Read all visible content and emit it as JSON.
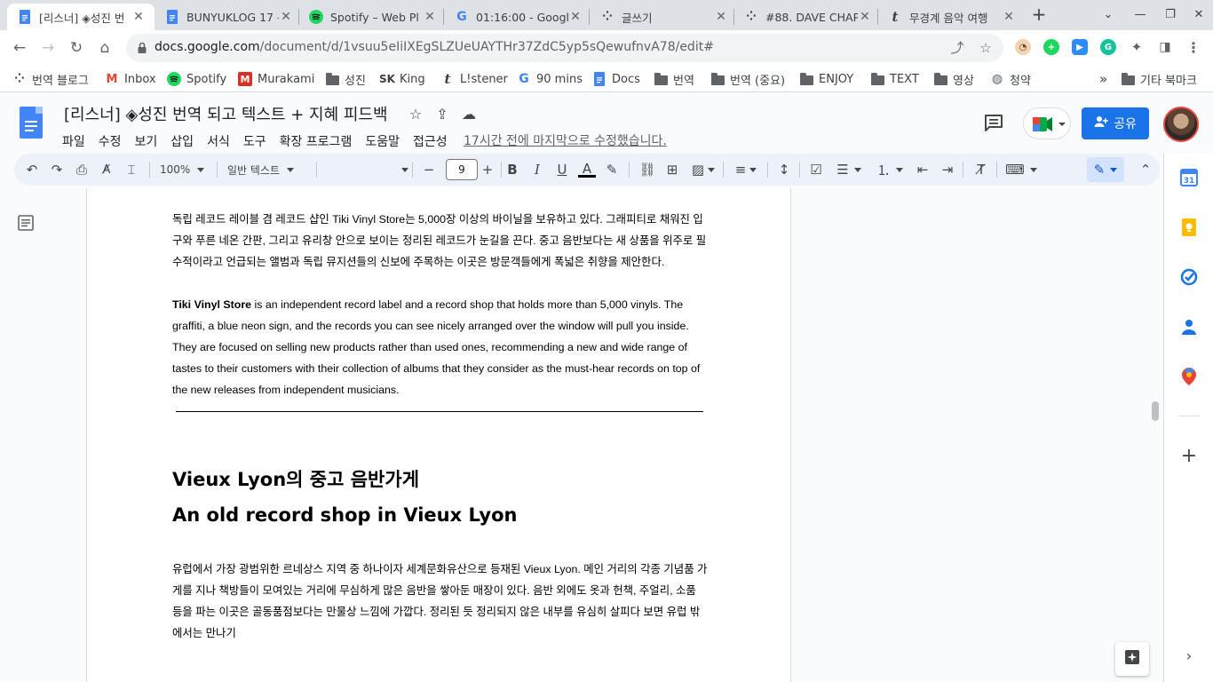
{
  "browser": {
    "tabs": [
      {
        "title": "[리스너] ◈성진 번",
        "icon": "docs-icon",
        "active": true
      },
      {
        "title": "BUNYUKLOG 17 -",
        "icon": "docs-icon",
        "active": false
      },
      {
        "title": "Spotify – Web Pl",
        "icon": "spotify-icon",
        "active": false
      },
      {
        "title": "01:16:00 - Googl",
        "icon": "google-icon",
        "active": false
      },
      {
        "title": "글쓰기",
        "icon": "dots-icon",
        "active": false
      },
      {
        "title": "#88. DAVE CHAP",
        "icon": "dots-icon",
        "active": false
      },
      {
        "title": "무경계 음악 여행",
        "icon": "t-icon",
        "active": false
      }
    ],
    "url_host": "docs.google.com",
    "url_path": "/document/d/1vsuu5eIiIXEgSLZUeUAYTHr37ZdC5yp5sQewufnvA78/edit#",
    "bookmarks": [
      {
        "label": "번역 블로그",
        "icon": "dots-icon"
      },
      {
        "label": "Inbox",
        "icon": "gmail-icon"
      },
      {
        "label": "Spotify",
        "icon": "spotify-icon"
      },
      {
        "label": "Murakami",
        "icon": "m-icon"
      },
      {
        "label": "성진",
        "icon": "folder-icon"
      },
      {
        "label": "King",
        "icon": "sk-icon"
      },
      {
        "label": "L!stener",
        "icon": "t-icon"
      },
      {
        "label": "90 mins",
        "icon": "google-icon"
      },
      {
        "label": "Docs",
        "icon": "docs-icon"
      },
      {
        "label": "번역",
        "icon": "folder-icon"
      },
      {
        "label": "번역 (중요)",
        "icon": "folder-icon"
      },
      {
        "label": "ENJOY",
        "icon": "folder-icon"
      },
      {
        "label": "TEXT",
        "icon": "folder-icon"
      },
      {
        "label": "영상",
        "icon": "folder-icon"
      },
      {
        "label": "청약",
        "icon": "globe-icon"
      }
    ],
    "bookmarks_overflow": "»",
    "other_bookmarks": "기타 북마크"
  },
  "docs": {
    "title": "[리스너] ◈성진 번역 되고 텍스트 + 지혜 피드백",
    "menu": [
      "파일",
      "수정",
      "보기",
      "삽입",
      "서식",
      "도구",
      "확장 프로그램",
      "도움말",
      "접근성"
    ],
    "last_edit": "17시간 전에 마지막으로 수정했습니다.",
    "share_label": "공유"
  },
  "toolbar": {
    "zoom": "100%",
    "style": "일반 텍스트",
    "font": "",
    "font_size": "9",
    "minus": "−",
    "plus": "+"
  },
  "document": {
    "para_ko_1": "독립 레코드 레이블 겸 레코드 샵인 Tiki Vinyl Store는 5,000장 이상의 바이닐을 보유하고 있다. 그래피티로 채워진 입구와 푸른 네온 간판, 그리고 유리창 안으로 보이는 정리된 레코드가 눈길을 끈다. 중고 음반보다는 새 상품을 위주로 필수적이라고 언급되는 앨범과 독립 뮤지션들의 신보에 주목하는 이곳은 방문객들에게 폭넓은 취향을 제안한다.",
    "para_en_bold": "Tiki Vinyl Store",
    "para_en_1": " is an independent record label and a record shop that holds more than 5,000 vinyls. The graffiti, a blue neon sign, and the records you can see nicely arranged over the window will pull you inside. They are focused on selling new products rather than used ones, recommending a new and wide range of tastes to their customers with their collection of albums that they consider as the must-hear records on top of the new releases from independent musicians.",
    "heading_ko": "Vieux Lyon의 중고 음반가게",
    "heading_en": "An old record shop in Vieux Lyon",
    "para_ko_2": "유럽에서 가장 광범위한 르네상스 지역 중 하나이자 세계문화유산으로 등재된 Vieux Lyon. 메인 거리의 각종 기념품 가게를 지나 책방들이 모여있는 거리에 무심하게 많은 음반을 쌓아둔 매장이 있다. 음반 외에도 옷과 헌책, 주얼리, 소품 등을 파는 이곳은 골동품점보다는 만물상 느낌에 가깝다. 정리된 듯 정리되지 않은 내부를 유심히 살피다 보면 유럽 밖에서는 만나기"
  },
  "colors": {
    "accent": "#1a73e8",
    "tab_strip": "#dee1e6",
    "toolbar_bg": "#edf2fa",
    "docs_blue": "#4285f4"
  }
}
